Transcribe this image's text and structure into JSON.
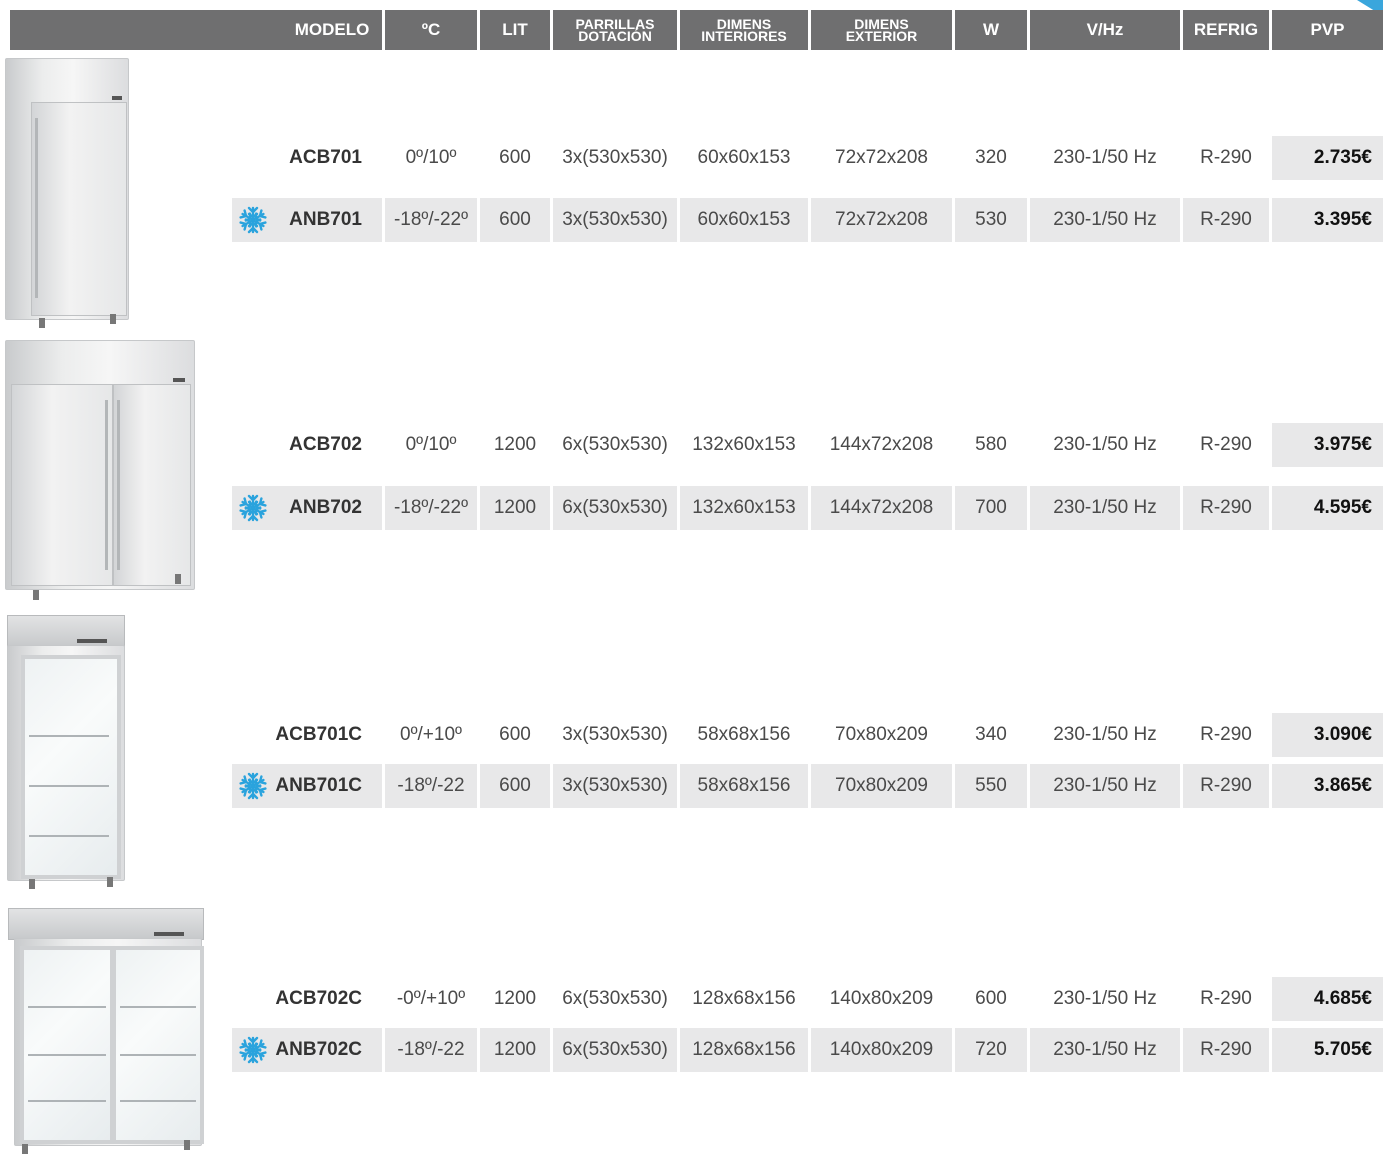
{
  "header": {
    "modelo": "MODELO",
    "temp": "ºC",
    "lit": "LIT",
    "parrillas_1": "PARRILLAS",
    "parrillas_2": "DOTACIÓN",
    "dimens_int_1": "DIMENS",
    "dimens_int_2": "INTERIORES",
    "dimens_ext_1": "DIMENS",
    "dimens_ext_2": "EXTERIOR",
    "w": "W",
    "vhz": "V/Hz",
    "refrig": "REFRIG",
    "pvp": "PVP"
  },
  "rows": [
    {
      "model": "ACB701",
      "temp": "0º/10º",
      "lit": "600",
      "parrillas": "3x(530x530)",
      "dim_int": "60x60x153",
      "dim_ext": "72x72x208",
      "w": "320",
      "vhz": "230-1/50 Hz",
      "refrig": "R-290",
      "pvp": "2.735€"
    },
    {
      "model": "ANB701",
      "temp": "-18º/-22º",
      "lit": "600",
      "parrillas": "3x(530x530)",
      "dim_int": "60x60x153",
      "dim_ext": "72x72x208",
      "w": "530",
      "vhz": "230-1/50 Hz",
      "refrig": "R-290",
      "pvp": "3.395€"
    },
    {
      "model": "ACB702",
      "temp": "0º/10º",
      "lit": "1200",
      "parrillas": "6x(530x530)",
      "dim_int": "132x60x153",
      "dim_ext": "144x72x208",
      "w": "580",
      "vhz": "230-1/50 Hz",
      "refrig": "R-290",
      "pvp": "3.975€"
    },
    {
      "model": "ANB702",
      "temp": "-18º/-22º",
      "lit": "1200",
      "parrillas": "6x(530x530)",
      "dim_int": "132x60x153",
      "dim_ext": "144x72x208",
      "w": "700",
      "vhz": "230-1/50 Hz",
      "refrig": "R-290",
      "pvp": "4.595€"
    },
    {
      "model": "ACB701C",
      "temp": "0º/+10º",
      "lit": "600",
      "parrillas": "3x(530x530)",
      "dim_int": "58x68x156",
      "dim_ext": "70x80x209",
      "w": "340",
      "vhz": "230-1/50 Hz",
      "refrig": "R-290",
      "pvp": "3.090€"
    },
    {
      "model": "ANB701C",
      "temp": "-18º/-22",
      "lit": "600",
      "parrillas": "3x(530x530)",
      "dim_int": "58x68x156",
      "dim_ext": "70x80x209",
      "w": "550",
      "vhz": "230-1/50 Hz",
      "refrig": "R-290",
      "pvp": "3.865€"
    },
    {
      "model": "ACB702C",
      "temp": "-0º/+10º",
      "lit": "1200",
      "parrillas": "6x(530x530)",
      "dim_int": "128x68x156",
      "dim_ext": "140x80x209",
      "w": "600",
      "vhz": "230-1/50 Hz",
      "refrig": "R-290",
      "pvp": "4.685€"
    },
    {
      "model": "ANB702C",
      "temp": "-18º/-22",
      "lit": "1200",
      "parrillas": "6x(530x530)",
      "dim_int": "128x68x156",
      "dim_ext": "140x80x209",
      "w": "720",
      "vhz": "230-1/50 Hz",
      "refrig": "R-290",
      "pvp": "5.705€"
    }
  ],
  "icons": {
    "freezer": "snowflake-icon",
    "product_image": "refrigerator-image"
  },
  "colors": {
    "header_bg": "#6f6f70",
    "row_band": "#e8e8e9",
    "snowflake": "#2aa3dd"
  }
}
